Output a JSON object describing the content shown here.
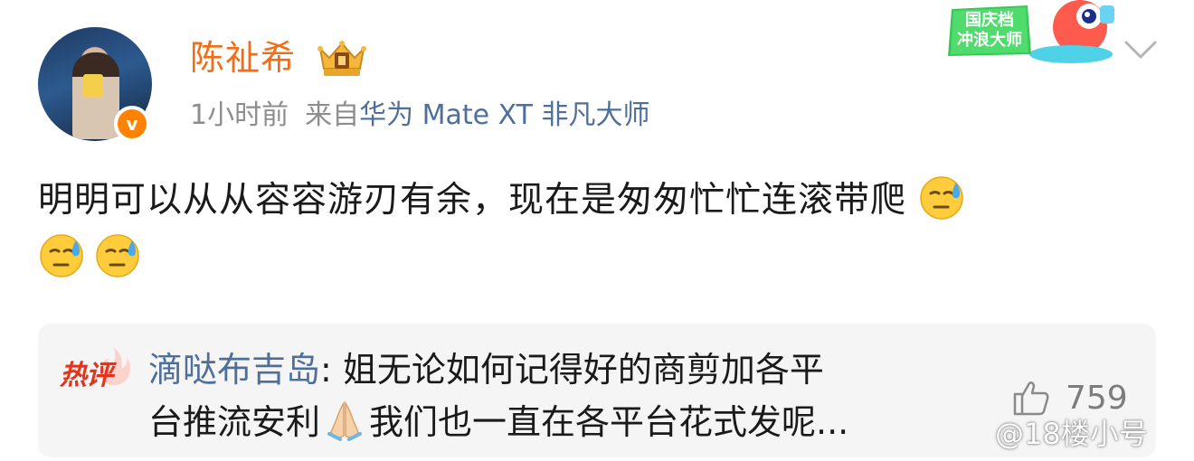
{
  "post": {
    "author": "陈祉希",
    "time": "1小时前",
    "source_prefix": "来自",
    "device": "华为 Mate XT 非凡大师",
    "content": "明明可以从从容容游刃有余，现在是匆匆忙忙连滚带爬",
    "emoji_name": "sweat-smile-emoji"
  },
  "badge": {
    "festival_line1": "国庆档",
    "festival_line2": "冲浪大师",
    "verify_mark": "v"
  },
  "hot_comment": {
    "tag": "热评",
    "commenter": "滴哒布吉岛",
    "separator": ":",
    "text_line1": " 姐无论如何记得好的商剪加各平",
    "text_line2_a": "台推流安利",
    "text_line2_b": "我们也一直在各平台花式发呢...",
    "likes": "759"
  },
  "watermark": "@18楼小号",
  "colors": {
    "author": "#f26d16",
    "link": "#4e6f9a",
    "meta": "#8d8d8d",
    "hot_tag": "#e5321c",
    "comment_bg": "#f5f5f5"
  }
}
